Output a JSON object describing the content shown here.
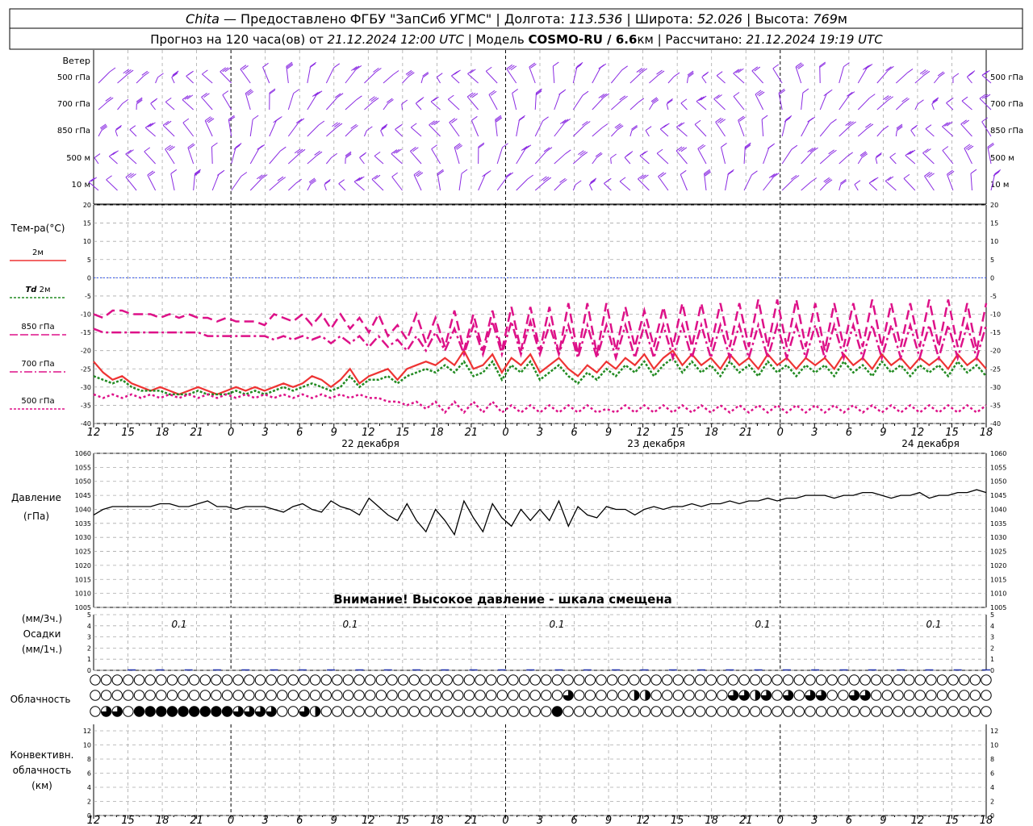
{
  "header": {
    "line1": {
      "city": "Chita",
      "provider": "Предоставлено ФГБУ \"ЗапСиб УГМС\"",
      "lon_label": "Долгота:",
      "lon": "113.536",
      "lat_label": "Широта:",
      "lat": "52.026",
      "alt_label": "Высота:",
      "alt": "769",
      "alt_unit": "м"
    },
    "line2": {
      "forecast": "Прогноз на 120 часа(ов) от",
      "start": "21.12.2024 12:00 UTC",
      "model_label": "Модель",
      "model": "COSMO-RU / 6.6",
      "model_unit": "км",
      "calc_label": "Рассчитано:",
      "calc": "21.12.2024 19:19 UTC"
    }
  },
  "wind_panel": {
    "title": "Ветер",
    "levels": [
      "500 гПа",
      "700 гПа",
      "850 гПа",
      "500 м",
      "10 м"
    ],
    "barb_color": "#8a2be2"
  },
  "temp_panel": {
    "title": "Тем-ра(°C)",
    "legend": [
      {
        "label": "2м",
        "color": "#ee3333",
        "style": "solid"
      },
      {
        "label_prefix": "Td",
        "label": "2м",
        "color": "#228b22",
        "style": "dotted"
      },
      {
        "label": "850 гПа",
        "color": "#dd1188",
        "style": "long-dash"
      },
      {
        "label": "700 гПа",
        "color": "#dd1188",
        "style": "dash-dot"
      },
      {
        "label": "500 гПа",
        "color": "#dd1188",
        "style": "dotted"
      }
    ],
    "yticks": [
      "20",
      "15",
      "10",
      "5",
      "0",
      "-5",
      "-10",
      "-15",
      "-20",
      "-25",
      "-30",
      "-35",
      "-40"
    ]
  },
  "time_axis": {
    "hour_labels": [
      "12",
      "15",
      "18",
      "21",
      "0",
      "3",
      "6",
      "9",
      "12",
      "15",
      "18",
      "21",
      "0",
      "3",
      "6",
      "9",
      "12",
      "15",
      "18",
      "21",
      "0",
      "3",
      "6",
      "9",
      "12",
      "15",
      "18"
    ],
    "day_labels": [
      "22 декабря",
      "23 декабря",
      "24 декабря"
    ]
  },
  "pressure_panel": {
    "title_line1": "Давление",
    "title_line2": "(гПа)",
    "yticks": [
      "1060",
      "1055",
      "1050",
      "1045",
      "1040",
      "1035",
      "1030",
      "1025",
      "1020",
      "1015",
      "1010",
      "1005"
    ],
    "warning": "Внимание! Высокое давление - шкала смещена"
  },
  "precip_panel": {
    "label_line1": "(мм/3ч.)",
    "label_line2": "Осадки",
    "label_line3": "(мм/1ч.)",
    "yticks": [
      "5",
      "4",
      "3",
      "2",
      "1",
      "0"
    ],
    "annotations": [
      "0.1",
      "0.1",
      "0.1",
      "0.1",
      "0.1"
    ]
  },
  "cloud_panel": {
    "title": "Облачность",
    "rows": [
      "0000000000000000000000000000000000000000000000000000000000000000000000000000000000",
      "0000000000000000000000000000000000000000000300000220000000332303033003300000000000",
      "0330444444444333300320000000000000000000004000000000000000000000000000000000000000"
    ]
  },
  "conv_panel": {
    "title_line1": "Конвективн.",
    "title_line2": "облачность",
    "title_line3": "(км)",
    "yticks": [
      "12",
      "10",
      "8",
      "6",
      "4",
      "2",
      "0"
    ]
  },
  "chart_data": [
    {
      "type": "line",
      "title": "Тем-ра(°C)",
      "ylim": [
        -40,
        20
      ],
      "x": [
        "12",
        "13",
        "14",
        "15",
        "16",
        "17",
        "18",
        "19",
        "20",
        "21",
        "0",
        "1",
        "2",
        "3",
        "4",
        "5",
        "6",
        "7",
        "8",
        "9",
        "10",
        "11",
        "12",
        "13",
        "14",
        "15",
        "16",
        "17",
        "18",
        "19",
        "20",
        "21",
        "0",
        "1",
        "2",
        "3",
        "4",
        "5",
        "6",
        "7",
        "8",
        "9",
        "10",
        "11",
        "12",
        "13",
        "14",
        "15",
        "16",
        "17",
        "18",
        "19",
        "20",
        "21",
        "0",
        "1",
        "2",
        "3",
        "4",
        "5",
        "6",
        "7",
        "8",
        "9",
        "10",
        "11",
        "12",
        "13",
        "14",
        "15",
        "16",
        "17",
        "18",
        "19",
        "20",
        "21",
        "0",
        "1",
        "2",
        "3",
        "4",
        "5",
        "6",
        "7",
        "8",
        "9",
        "10",
        "11",
        "12",
        "13",
        "14",
        "15",
        "16",
        "17",
        "18"
      ],
      "series": [
        {
          "name": "2м",
          "values": [
            -23,
            -26,
            -28,
            -27,
            -29,
            -30,
            -31,
            -30,
            -31,
            -32,
            -31,
            -30,
            -31,
            -32,
            -31,
            -30,
            -31,
            -30,
            -31,
            -30,
            -29,
            -30,
            -29,
            -27,
            -28,
            -30,
            -28,
            -25,
            -29,
            -27,
            -26,
            -25,
            -28,
            -25,
            -24,
            -23,
            -24,
            -22,
            -24,
            -20,
            -25,
            -24,
            -21,
            -26,
            -22,
            -24,
            -21,
            -26,
            -24,
            -22,
            -25,
            -27,
            -24,
            -26,
            -23,
            -25,
            -22,
            -24,
            -21,
            -25,
            -22,
            -20,
            -24,
            -21,
            -24,
            -22,
            -25,
            -21,
            -24,
            -22,
            -25,
            -21,
            -24,
            -22,
            -25,
            -22,
            -24,
            -22,
            -25,
            -21,
            -24,
            -22,
            -25,
            -21,
            -24,
            -22,
            -25,
            -22,
            -24,
            -22,
            -25,
            -21,
            -24,
            -22,
            -25
          ]
        },
        {
          "name": "Td 2м",
          "values": [
            -27,
            -28,
            -29,
            -28,
            -30,
            -31,
            -31,
            -31,
            -32,
            -32,
            -32,
            -31,
            -32,
            -32,
            -32,
            -31,
            -32,
            -31,
            -32,
            -31,
            -30,
            -31,
            -30,
            -29,
            -30,
            -31,
            -30,
            -27,
            -30,
            -28,
            -28,
            -27,
            -29,
            -27,
            -26,
            -25,
            -26,
            -24,
            -26,
            -23,
            -27,
            -26,
            -23,
            -28,
            -24,
            -26,
            -23,
            -28,
            -26,
            -24,
            -27,
            -29,
            -26,
            -28,
            -25,
            -27,
            -24,
            -26,
            -23,
            -27,
            -24,
            -22,
            -26,
            -23,
            -26,
            -24,
            -27,
            -23,
            -26,
            -24,
            -27,
            -23,
            -26,
            -24,
            -27,
            -24,
            -26,
            -24,
            -27,
            -23,
            -26,
            -24,
            -27,
            -23,
            -26,
            -24,
            -27,
            -24,
            -26,
            -24,
            -27,
            -23,
            -26,
            -24,
            -27
          ]
        },
        {
          "name": "850 гПа",
          "values": [
            -10,
            -11,
            -9,
            -9,
            -10,
            -10,
            -10,
            -11,
            -10,
            -11,
            -10,
            -11,
            -11,
            -12,
            -11,
            -12,
            -12,
            -12,
            -13,
            -10,
            -11,
            -12,
            -10,
            -13,
            -10,
            -14,
            -10,
            -14,
            -11,
            -15,
            -10,
            -16,
            -13,
            -17,
            -10,
            -18,
            -11,
            -19,
            -9,
            -20,
            -10,
            -20,
            -9,
            -20,
            -8,
            -20,
            -8,
            -20,
            -8,
            -21,
            -7,
            -21,
            -7,
            -21,
            -7,
            -20,
            -8,
            -19,
            -9,
            -19,
            -8,
            -19,
            -7,
            -19,
            -7,
            -19,
            -7,
            -19,
            -7,
            -19,
            -6,
            -19,
            -6,
            -19,
            -6,
            -19,
            -7,
            -20,
            -7,
            -19,
            -7,
            -19,
            -6,
            -19,
            -7,
            -19,
            -7,
            -19,
            -6,
            -19,
            -6,
            -19,
            -7,
            -20,
            -7
          ]
        },
        {
          "name": "700 гПа",
          "values": [
            -14,
            -15,
            -15,
            -15,
            -15,
            -15,
            -15,
            -15,
            -15,
            -15,
            -15,
            -15,
            -16,
            -16,
            -16,
            -16,
            -16,
            -16,
            -16,
            -17,
            -16,
            -17,
            -16,
            -17,
            -16,
            -18,
            -16,
            -18,
            -16,
            -19,
            -16,
            -19,
            -17,
            -20,
            -16,
            -20,
            -15,
            -20,
            -14,
            -21,
            -13,
            -21,
            -12,
            -21,
            -12,
            -21,
            -12,
            -21,
            -13,
            -21,
            -13,
            -22,
            -13,
            -22,
            -13,
            -22,
            -13,
            -22,
            -13,
            -22,
            -13,
            -22,
            -13,
            -22,
            -13,
            -22,
            -13,
            -22,
            -13,
            -22,
            -13,
            -22,
            -13,
            -22,
            -13,
            -22,
            -13,
            -22,
            -13,
            -22,
            -13,
            -22,
            -13,
            -22,
            -13,
            -22,
            -13,
            -22,
            -13,
            -22,
            -13,
            -22,
            -13,
            -22,
            -13
          ]
        },
        {
          "name": "500 гПа",
          "values": [
            -32,
            -33,
            -32,
            -33,
            -32,
            -33,
            -32,
            -33,
            -32,
            -33,
            -32,
            -33,
            -32,
            -33,
            -32,
            -33,
            -32,
            -33,
            -32,
            -33,
            -32,
            -33,
            -32,
            -33,
            -32,
            -33,
            -32,
            -33,
            -32,
            -33,
            -33,
            -34,
            -34,
            -35,
            -34,
            -36,
            -34,
            -37,
            -34,
            -37,
            -34,
            -37,
            -34,
            -37,
            -35,
            -37,
            -35,
            -37,
            -35,
            -37,
            -35,
            -37,
            -35,
            -37,
            -36,
            -37,
            -35,
            -37,
            -35,
            -37,
            -35,
            -37,
            -35,
            -37,
            -35,
            -37,
            -35,
            -37,
            -35,
            -37,
            -35,
            -37,
            -35,
            -37,
            -35,
            -37,
            -35,
            -37,
            -35,
            -37,
            -35,
            -37,
            -35,
            -37,
            -35,
            -37,
            -35,
            -37,
            -35,
            -37,
            -35,
            -37,
            -35,
            -37,
            -35
          ]
        }
      ]
    },
    {
      "type": "line",
      "title": "Давление (гПа)",
      "ylim": [
        1005,
        1060
      ],
      "x": [
        "12",
        "13",
        "14",
        "15",
        "16",
        "17",
        "18",
        "19",
        "20",
        "21",
        "0",
        "1",
        "2",
        "3",
        "4",
        "5",
        "6",
        "7",
        "8",
        "9",
        "10",
        "11",
        "12",
        "13",
        "14",
        "15",
        "16",
        "17",
        "18",
        "19",
        "20",
        "21",
        "0",
        "1",
        "2",
        "3",
        "4",
        "5",
        "6",
        "7",
        "8",
        "9",
        "10",
        "11",
        "12",
        "13",
        "14",
        "15",
        "16",
        "17",
        "18",
        "19",
        "20",
        "21",
        "0",
        "1",
        "2",
        "3",
        "4",
        "5",
        "6",
        "7",
        "8",
        "9",
        "10",
        "11",
        "12",
        "13",
        "14",
        "15",
        "16",
        "17",
        "18",
        "19",
        "20",
        "21",
        "0",
        "1",
        "2",
        "3",
        "4",
        "5",
        "6",
        "7",
        "8",
        "9",
        "10",
        "11",
        "12",
        "13",
        "14",
        "15",
        "16",
        "17",
        "18"
      ],
      "series": [
        {
          "name": "Давление",
          "values": [
            1038,
            1040,
            1041,
            1041,
            1041,
            1041,
            1041,
            1042,
            1042,
            1041,
            1041,
            1042,
            1043,
            1041,
            1041,
            1040,
            1041,
            1041,
            1041,
            1040,
            1039,
            1041,
            1042,
            1040,
            1039,
            1043,
            1041,
            1040,
            1038,
            1044,
            1041,
            1038,
            1036,
            1042,
            1036,
            1032,
            1040,
            1036,
            1031,
            1043,
            1037,
            1032,
            1042,
            1037,
            1034,
            1040,
            1036,
            1040,
            1036,
            1043,
            1034,
            1041,
            1038,
            1037,
            1041,
            1040,
            1040,
            1038,
            1040,
            1041,
            1040,
            1041,
            1041,
            1042,
            1041,
            1042,
            1042,
            1043,
            1042,
            1043,
            1043,
            1044,
            1043,
            1044,
            1044,
            1045,
            1045,
            1045,
            1044,
            1045,
            1045,
            1046,
            1046,
            1045,
            1044,
            1045,
            1045,
            1046,
            1044,
            1045,
            1045,
            1046,
            1046,
            1047,
            1046
          ]
        }
      ]
    }
  ]
}
